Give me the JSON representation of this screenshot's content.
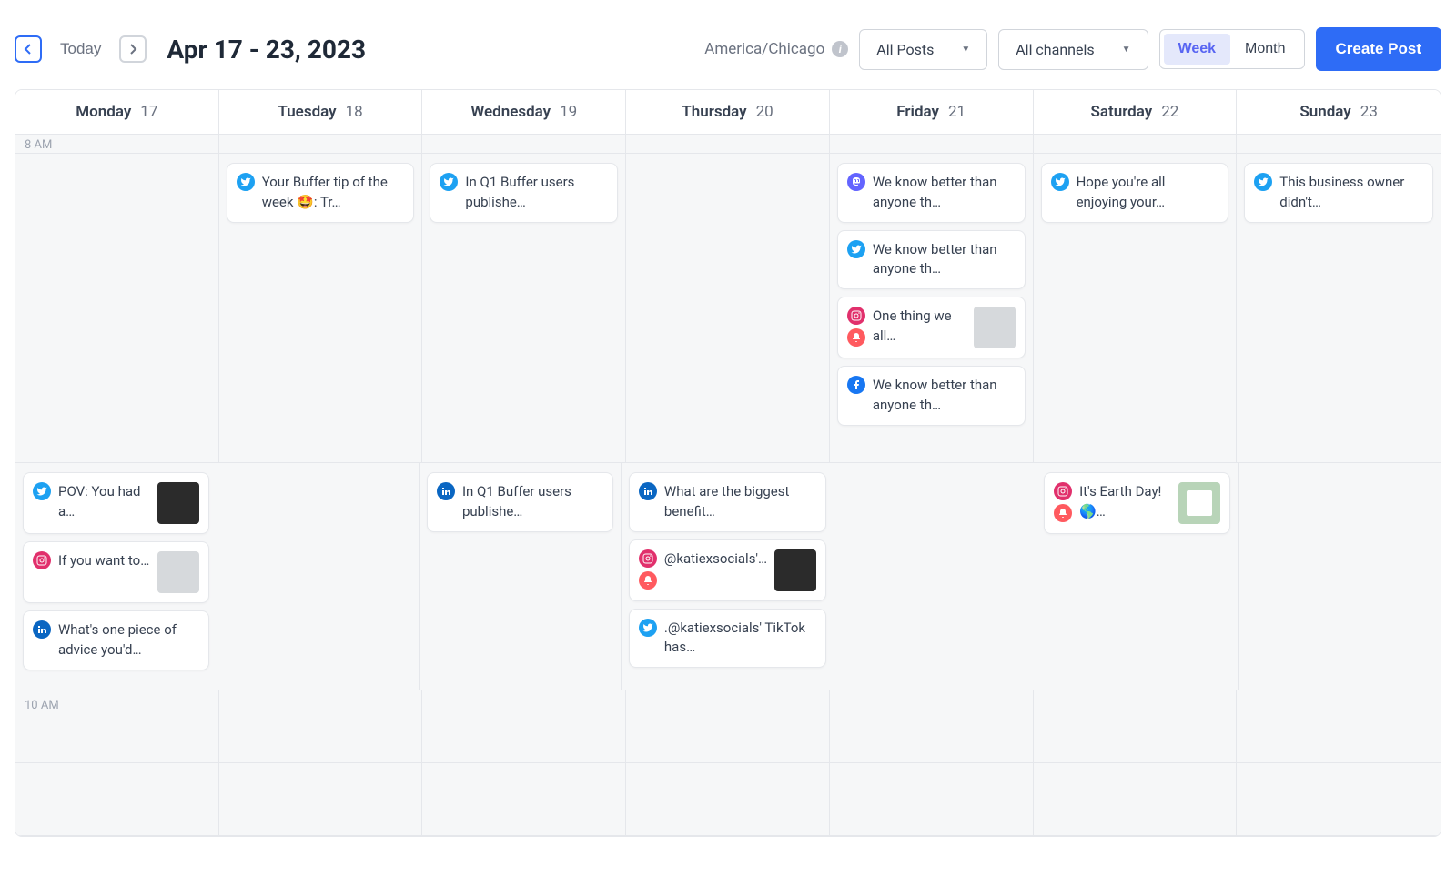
{
  "header": {
    "today_label": "Today",
    "date_range": "Apr 17 - 23, 2023",
    "timezone": "America/Chicago",
    "posts_filter": "All Posts",
    "channels_filter": "All channels",
    "view_week": "Week",
    "view_month": "Month",
    "create_label": "Create Post"
  },
  "days": [
    {
      "name": "Monday",
      "num": "17"
    },
    {
      "name": "Tuesday",
      "num": "18"
    },
    {
      "name": "Wednesday",
      "num": "19"
    },
    {
      "name": "Thursday",
      "num": "20"
    },
    {
      "name": "Friday",
      "num": "21"
    },
    {
      "name": "Saturday",
      "num": "22"
    },
    {
      "name": "Sunday",
      "num": "23"
    }
  ],
  "time_labels": {
    "t8": "8 AM",
    "t10": "10 AM"
  },
  "slots": {
    "am8": {
      "mon": [],
      "tue": [
        {
          "channels": [
            "twitter"
          ],
          "text": "Your Buffer tip of the week 🤩: Tr…"
        }
      ],
      "wed": [
        {
          "channels": [
            "twitter"
          ],
          "text": "In Q1 Buffer users publishe…"
        }
      ],
      "thu": [],
      "fri": [
        {
          "channels": [
            "mastodon"
          ],
          "text": "We know better than anyone th…"
        },
        {
          "channels": [
            "twitter"
          ],
          "text": "We know better than anyone th…"
        },
        {
          "channels": [
            "instagram",
            "bell"
          ],
          "text": "One thing we all…",
          "thumb": "light"
        },
        {
          "channels": [
            "facebook"
          ],
          "text": "We know better than anyone th…"
        }
      ],
      "sat": [
        {
          "channels": [
            "twitter"
          ],
          "text": "Hope you're all enjoying your…"
        }
      ],
      "sun": [
        {
          "channels": [
            "twitter"
          ],
          "text": "This business owner didn't…"
        }
      ]
    },
    "am9": {
      "mon": [
        {
          "channels": [
            "twitter"
          ],
          "text": "POV: You had a…",
          "thumb": "dark"
        },
        {
          "channels": [
            "instagram"
          ],
          "text": "If you want to…",
          "thumb": "light"
        },
        {
          "channels": [
            "linkedin"
          ],
          "text": "What's one piece of advice you'd…"
        }
      ],
      "tue": [],
      "wed": [
        {
          "channels": [
            "linkedin"
          ],
          "text": "In Q1 Buffer users publishe…"
        }
      ],
      "thu": [
        {
          "channels": [
            "linkedin"
          ],
          "text": "What are the biggest benefit…"
        },
        {
          "channels": [
            "instagram",
            "bell"
          ],
          "text": "@katiexsocials'…",
          "thumb": "dark"
        },
        {
          "channels": [
            "twitter"
          ],
          "text": ".@katiexsocials' TikTok has…"
        }
      ],
      "fri": [],
      "sat": [
        {
          "channels": [
            "instagram",
            "bell"
          ],
          "text": "It's Earth Day! 🌎…",
          "thumb": "green"
        }
      ],
      "sun": []
    }
  }
}
